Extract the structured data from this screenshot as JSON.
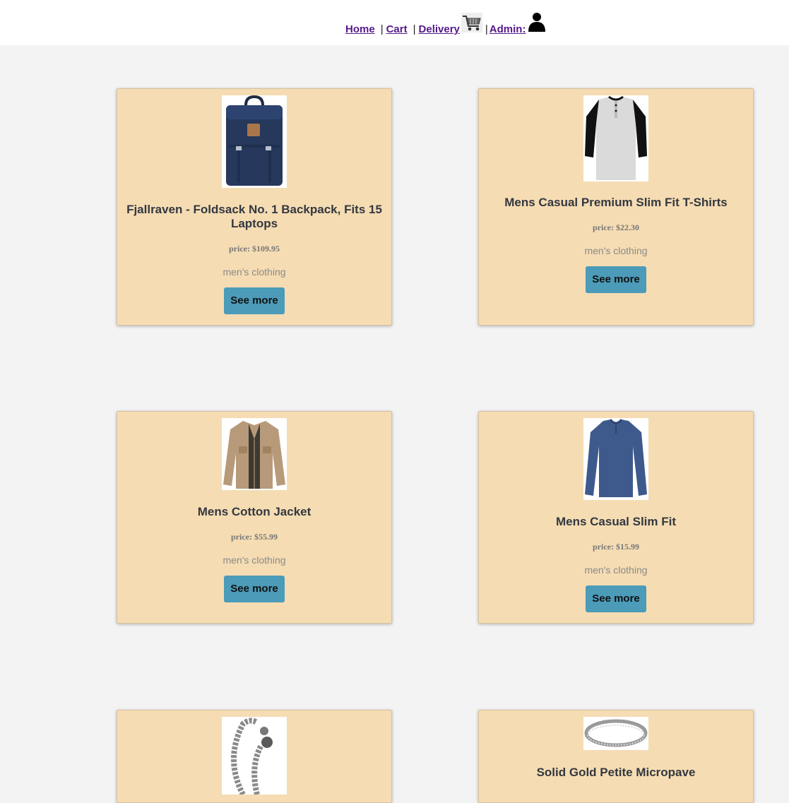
{
  "nav": {
    "home": "Home",
    "cart": "Cart",
    "delivery": "Delivery",
    "admin": "Admin:",
    "separator": "|",
    "icons": [
      "cart-icon",
      "user-icon"
    ]
  },
  "products": [
    {
      "title": "Fjallraven - Foldsack No. 1 Backpack, Fits 15 Laptops",
      "price": "price: $109.95",
      "category": "men's clothing",
      "button": "See more",
      "image": "backpack-image"
    },
    {
      "title": "Mens Casual Premium Slim Fit T-Shirts",
      "price": "price: $22.30",
      "category": "men's clothing",
      "button": "See more",
      "image": "tshirt-image"
    },
    {
      "title": "Mens Cotton Jacket",
      "price": "price: $55.99",
      "category": "men's clothing",
      "button": "See more",
      "image": "jacket-image"
    },
    {
      "title": "Mens Casual Slim Fit",
      "price": "price: $15.99",
      "category": "men's clothing",
      "button": "See more",
      "image": "longsleeve-image"
    },
    {
      "title": "",
      "price": "",
      "category": "",
      "button": "",
      "image": "bracelet-image"
    },
    {
      "title": "Solid Gold Petite Micropave",
      "price": "",
      "category": "",
      "button": "",
      "image": "ring-image"
    }
  ],
  "colors": {
    "card": "#f5dcb3",
    "button": "#4b9bb9",
    "page": "#f3f3f4",
    "link": "#551a8b"
  }
}
